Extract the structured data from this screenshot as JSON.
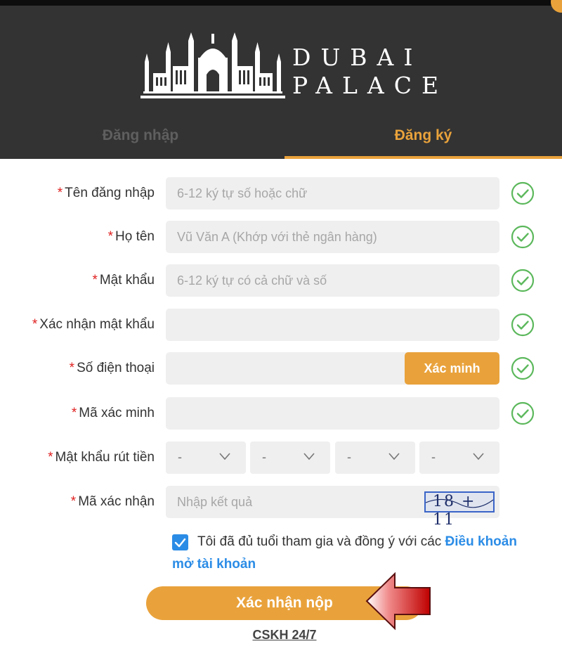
{
  "brand": {
    "line1": "DUBAI",
    "line2": "PALACE"
  },
  "tabs": {
    "login": "Đăng nhập",
    "register": "Đăng ký"
  },
  "form": {
    "username": {
      "label": "Tên đăng nhập",
      "placeholder": "6-12 ký tự số hoặc chữ",
      "value": ""
    },
    "fullname": {
      "label": "Họ tên",
      "placeholder": "Vũ Văn A (Khớp với thẻ ngân hàng)",
      "value": ""
    },
    "password": {
      "label": "Mật khẩu",
      "placeholder": "6-12 ký tự có cả chữ và số",
      "value": ""
    },
    "confirm_password": {
      "label": "Xác nhận mật khẩu",
      "placeholder": "",
      "value": ""
    },
    "phone": {
      "label": "Số điện thoại",
      "placeholder": "",
      "value": "",
      "verify_button": "Xác minh"
    },
    "verify_code": {
      "label": "Mã xác minh",
      "placeholder": "",
      "value": ""
    },
    "withdraw_pin": {
      "label": "Mật khẩu rút tiền",
      "digits": [
        "-",
        "-",
        "-",
        "-"
      ]
    },
    "captcha": {
      "label": "Mã xác nhận",
      "placeholder": "Nhập kết quả",
      "image_text": "18 + 11"
    }
  },
  "agreement": {
    "checked": true,
    "text": "Tôi đã đủ tuổi tham gia và đồng ý với các ",
    "link": "Điều khoản mở tài khoản"
  },
  "submit_label": "Xác nhận nộp",
  "support_link": "CSKH 24/7",
  "colors": {
    "accent": "#e9a23b",
    "header_bg": "#333333",
    "valid": "#5cb85c",
    "link": "#2b8ce6",
    "required": "#e02020"
  },
  "icons": {
    "valid": "check-circle-icon",
    "dropdown": "chevron-down-icon",
    "arrow": "red-arrow-pointer"
  }
}
